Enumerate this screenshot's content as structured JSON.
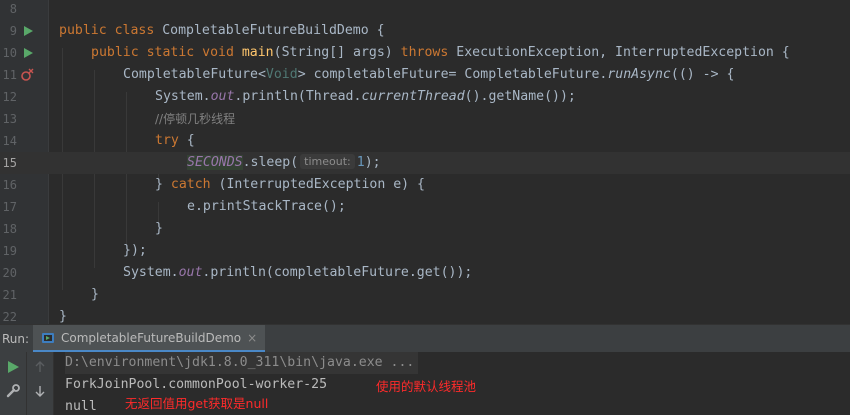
{
  "editor": {
    "lines": [
      {
        "num": "8"
      },
      {
        "num": "9",
        "code": {
          "kw1": "public class ",
          "cls": "CompletableFutureBuildDemo",
          "rest": " {"
        }
      },
      {
        "num": "10",
        "code": {
          "kw1": "public static void ",
          "fn": "main",
          "p1": "(String[] args) ",
          "kw2": "throws",
          "p2": " ExecutionException, InterruptedException {"
        }
      },
      {
        "num": "11",
        "code": {
          "t1": "CompletableFuture<",
          "gen": "Void",
          "t2": "> completableFuture= CompletableFuture.",
          "st": "runAsync",
          "t3": "(() -> {"
        }
      },
      {
        "num": "12",
        "code": {
          "t1": "System.",
          "fld": "out",
          "t2": ".println(Thread.",
          "st": "currentThread",
          "t3": "().getName());"
        }
      },
      {
        "num": "13",
        "code": {
          "cmt": "//停顿几秒线程"
        }
      },
      {
        "num": "14",
        "code": {
          "kw": "try",
          "t1": " {"
        }
      },
      {
        "num": "15",
        "code": {
          "enum": "SECONDS",
          "t1": ".sleep(",
          "hint": "timeout:",
          "num": "1",
          "t2": ");"
        }
      },
      {
        "num": "16",
        "code": {
          "t1": "} ",
          "kw": "catch",
          "t2": " (InterruptedException e) {"
        }
      },
      {
        "num": "17",
        "code": {
          "t1": "e.printStackTrace();"
        }
      },
      {
        "num": "18",
        "code": {
          "t1": "}"
        }
      },
      {
        "num": "19",
        "code": {
          "t1": "});"
        }
      },
      {
        "num": "20",
        "code": {
          "t1": "System.",
          "fld": "out",
          "t2": ".println(completableFuture.get());"
        }
      },
      {
        "num": "21",
        "code": {
          "t1": "}"
        }
      },
      {
        "num": "22",
        "code": {
          "t1": "}"
        }
      }
    ]
  },
  "run": {
    "label": "Run:",
    "tab_label": "CompletableFutureBuildDemo",
    "close_glyph": "×"
  },
  "console": {
    "cmd": "D:\\environment\\jdk1.8.0_311\\bin\\java.exe ...",
    "out1": "ForkJoinPool.commonPool-worker-25",
    "out2": "null",
    "annotation1": "使用的默认线程池",
    "annotation2": "无返回值用get获取是null"
  },
  "colors": {
    "run_green": "#59a869",
    "annotation_red": "#ff2b2b",
    "tab_underline": "#4a88c7"
  }
}
